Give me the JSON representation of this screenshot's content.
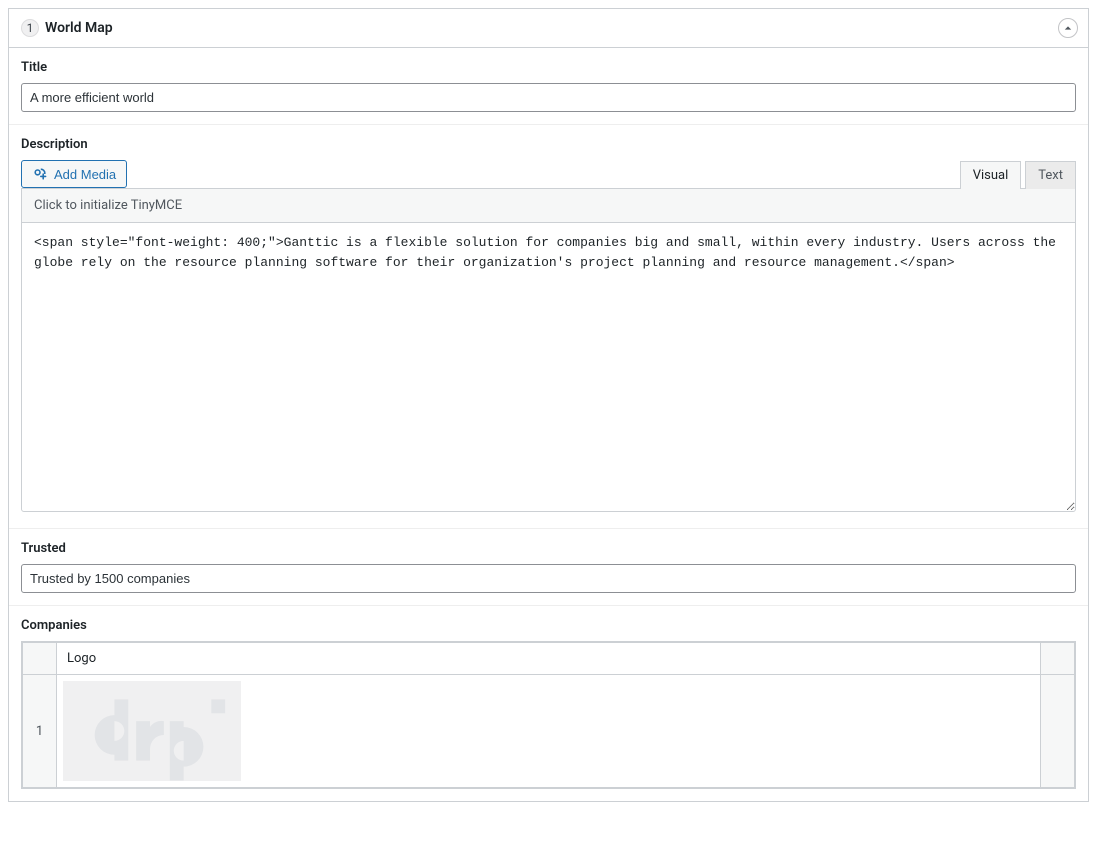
{
  "panel": {
    "index": "1",
    "title": "World Map"
  },
  "fields": {
    "title_label": "Title",
    "title_value": "A more efficient world",
    "description_label": "Description",
    "add_media_label": "Add Media",
    "tab_visual": "Visual",
    "tab_text": "Text",
    "init_hint": "Click to initialize TinyMCE",
    "description_value": "<span style=\"font-weight: 400;\">Ganttic is a flexible solution for companies big and small, within every industry. Users across the globe rely on the resource planning software for their organization's project planning and resource management.</span>",
    "trusted_label": "Trusted",
    "trusted_value": "Trusted by 1500 companies",
    "companies_label": "Companies",
    "companies_col_logo": "Logo",
    "companies_rows": [
      {
        "num": "1",
        "logo_name": "drp"
      }
    ]
  }
}
